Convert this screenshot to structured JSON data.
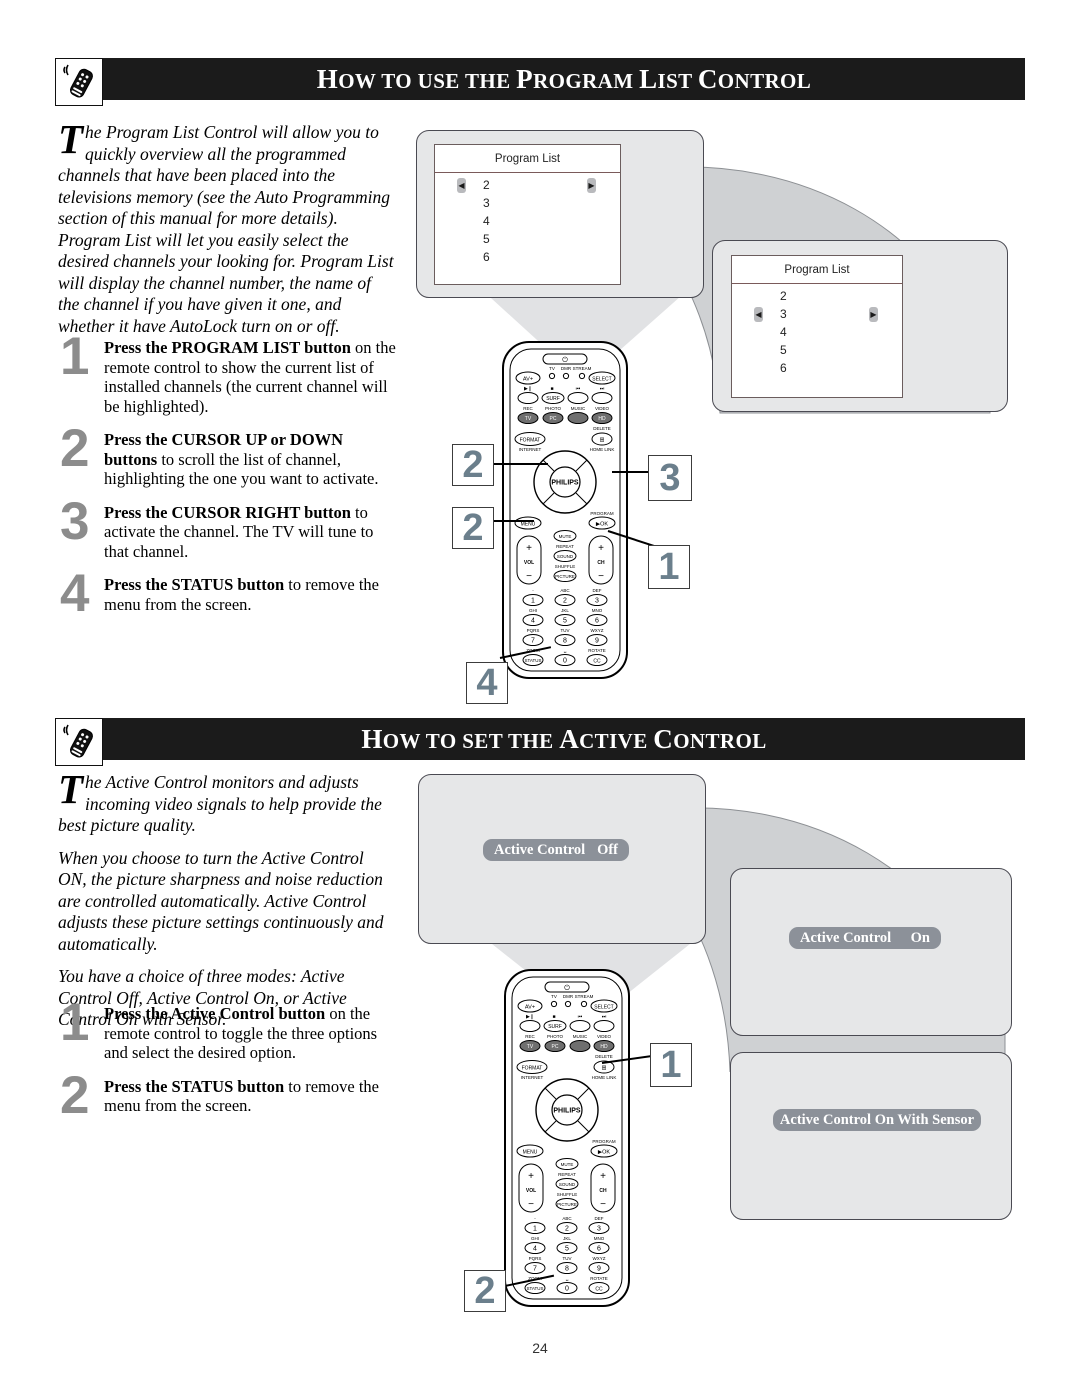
{
  "page": {
    "number": "24"
  },
  "sections": [
    {
      "id": "program-list",
      "icon": "remote-control-icon",
      "title_parts": [
        {
          "cap": "H",
          "rest": "OW"
        },
        {
          "cap": "",
          "rest": " TO USE THE "
        },
        {
          "cap": "P",
          "rest": "ROGRAM"
        },
        {
          "cap": "",
          "rest": " "
        },
        {
          "cap": "L",
          "rest": "IST"
        },
        {
          "cap": "",
          "rest": " "
        },
        {
          "cap": "C",
          "rest": "ONTROL"
        }
      ],
      "title_plain": "HOW TO USE THE PROGRAM LIST CONTROL",
      "intro": [
        "he Program List Control will allow you to quickly overview all the programmed channels that have been placed into the televisions memory (see the Auto Programming section of this manual for more details). Program List will let you easily select the desired channels your looking for. Program List will display the channel number, the name of the channel if you have given it one, and whether it have AutoLock turn on or off."
      ],
      "dropcap": "T",
      "steps": [
        {
          "num": "1",
          "bold": "Press the PROGRAM LIST button",
          "rest": " on the remote control to show the current list of installed channels (the current channel will be highlighted)."
        },
        {
          "num": "2",
          "bold": "Press the CURSOR UP or DOWN buttons",
          "rest": " to scroll the list of channel, highlighting the one you want to activate."
        },
        {
          "num": "3",
          "bold": "Press the CURSOR RIGHT button",
          "rest": " to activate the channel. The TV will tune to that channel."
        },
        {
          "num": "4",
          "bold": "Press the STATUS button",
          "rest": " to remove the menu from the screen."
        }
      ],
      "tv_panels": [
        {
          "title": "Program List",
          "channels": [
            "2",
            "3",
            "4",
            "5",
            "6"
          ],
          "cursor_index": 0
        },
        {
          "title": "Program List",
          "channels": [
            "2",
            "3",
            "4",
            "5",
            "6"
          ],
          "cursor_index": 1
        }
      ],
      "callouts": [
        "2",
        "3",
        "2",
        "1",
        "4"
      ]
    },
    {
      "id": "active-control",
      "icon": "remote-control-icon",
      "title_plain": "HOW TO SET THE ACTIVE CONTROL",
      "dropcap": "T",
      "intro": [
        "he Active Control monitors and adjusts incoming video signals to help provide the best picture quality.",
        "When you choose to turn the Active Control ON, the picture sharpness and noise reduction are controlled automatically. Active Control adjusts these picture settings continuously and automatically.",
        "You have a choice of three modes: Active Control Off, Active Control On, or Active Control On with Sensor."
      ],
      "steps": [
        {
          "num": "1",
          "bold": "Press the Active Control button",
          "rest": " on the remote control to toggle the three options and select the desired option."
        },
        {
          "num": "2",
          "bold": "Press the STATUS button",
          "rest": " to remove the menu from the screen."
        }
      ],
      "osd_banners": [
        {
          "label": "Active Control",
          "value": "Off"
        },
        {
          "label": "Active Control",
          "value": "On"
        },
        {
          "label": "Active Control On With Sensor",
          "value": ""
        }
      ],
      "callouts": [
        "1",
        "2"
      ]
    }
  ],
  "remote": {
    "brand": "PHILIPS",
    "power": "⏻",
    "row_av": {
      "left": "AV+",
      "right": "SELECT"
    },
    "indicators": [
      "TV",
      "DMR",
      "STREAM"
    ],
    "transport_top": [
      "▶‖",
      "■",
      "⏮",
      "⏭"
    ],
    "transport_btns": [
      "◎",
      "SURF",
      "◷",
      "◰"
    ],
    "media_labels": [
      "REC",
      "PHOTO",
      "MUSIC",
      "VIDEO"
    ],
    "media_btns": [
      "TV",
      "PC",
      "▣",
      "HD"
    ],
    "format": "FORMAT",
    "internet": "INTERNET",
    "delete": "DELETE",
    "homelink": "HOME LINK",
    "delete_btn": "⊞",
    "menu": "MENU",
    "program": "PROGRAM",
    "ok": "▶ OK",
    "vol": "VOL",
    "ch": "CH",
    "mid_labels": [
      "MUTE",
      "REPEAT",
      "SOUND",
      "SHUFFLE",
      "PICTURE"
    ],
    "keypad": [
      {
        "sub": "-",
        "key": "1"
      },
      {
        "sub": "ABC",
        "key": "2"
      },
      {
        "sub": "DEF",
        "key": "3"
      },
      {
        "sub": "GHI",
        "key": "4"
      },
      {
        "sub": "JKL",
        "key": "5"
      },
      {
        "sub": "MNO",
        "key": "6"
      },
      {
        "sub": "PQRS",
        "key": "7"
      },
      {
        "sub": "TUV",
        "key": "8"
      },
      {
        "sub": "WXYZ",
        "key": "9"
      },
      {
        "sub": "ZOOM",
        "key": "STATUS"
      },
      {
        "sub": "␣",
        "key": "0"
      },
      {
        "sub": "ROTATE",
        "key": "CC"
      }
    ]
  },
  "colors": {
    "band_bg": "#1b1b1b",
    "step_number": "#8c8c8c",
    "callout_text": "#6b7f8c",
    "tv_body": "#e6e7e8",
    "swoosh": "#cfd1d3",
    "osd_bg": "#8c9199"
  }
}
